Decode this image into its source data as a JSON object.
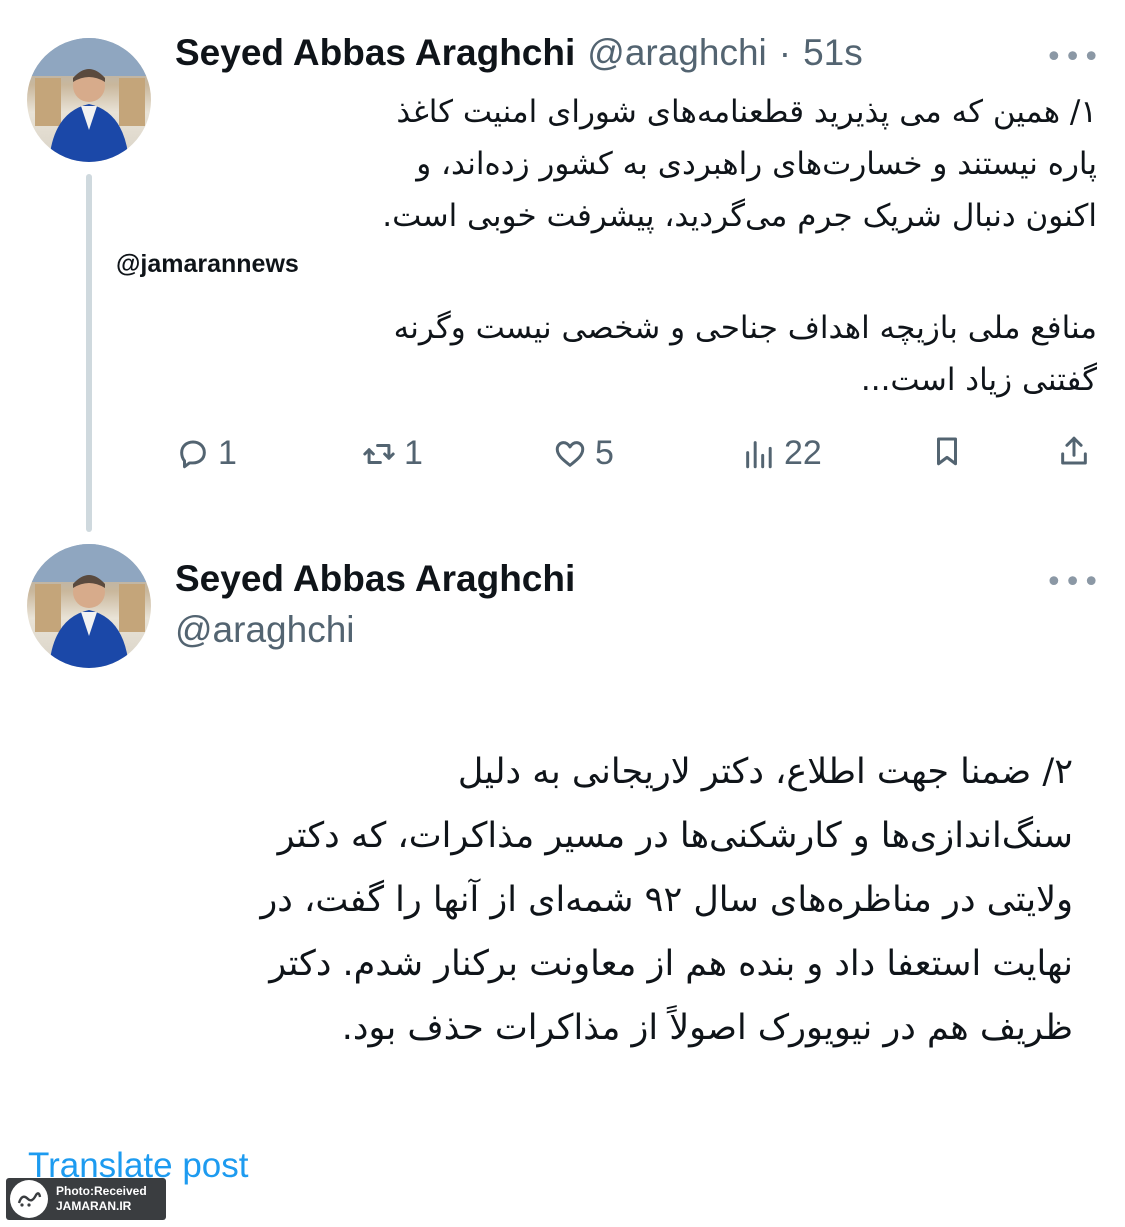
{
  "tweet1": {
    "author_name": "Seyed Abbas Araghchi",
    "handle": "@araghchi",
    "separator": "·",
    "time": "51s",
    "more": "•••",
    "lines": [
      "۱/ همین که می پذیرید قطعنامه‌های شورای امنیت کاغذ",
      "پاره نیستند و خسارت‌های راهبردی به کشور زده‌اند، و",
      "اکنون دنبال شریک جرم می‌گردید، پیشرفت خوبی است."
    ],
    "lines2": [
      "منافع ملی بازیچه اهداف جناحی و شخصی نیست وگرنه",
      "گفتنی زیاد است..."
    ],
    "actions": {
      "reply_count": "1",
      "repost_count": "1",
      "like_count": "5",
      "views_count": "22"
    },
    "icons": [
      "reply-icon",
      "repost-icon",
      "like-icon",
      "views-icon",
      "bookmark-icon",
      "share-icon"
    ]
  },
  "watermark": "@jamarannews",
  "tweet2": {
    "author_name": "Seyed Abbas Araghchi",
    "handle": "@araghchi",
    "more": "•••",
    "lines": [
      "۲/ ضمنا جهت اطلاع، دکتر لاریجانی به دلیل",
      "سنگ‌اندازی‌ها و کارشکنی‌ها در مسیر مذاکرات، که دکتر",
      "ولایتی در مناظره‌های سال ۹۲ شمه‌ای از آنها را گفت، در",
      "نهایت استعفا داد و بنده هم از معاونت برکنار شدم. دکتر",
      "ظریف هم در نیویورک اصولاً از مذاکرات حذف بود."
    ],
    "translate": "Translate post"
  },
  "badge": {
    "line1": "Photo:Received",
    "line2": "JAMARAN.IR",
    "logo_text": "جماران"
  },
  "colors": {
    "link": "#1d9bf0",
    "secondary": "#536471",
    "thread_line": "#cfd9de"
  }
}
